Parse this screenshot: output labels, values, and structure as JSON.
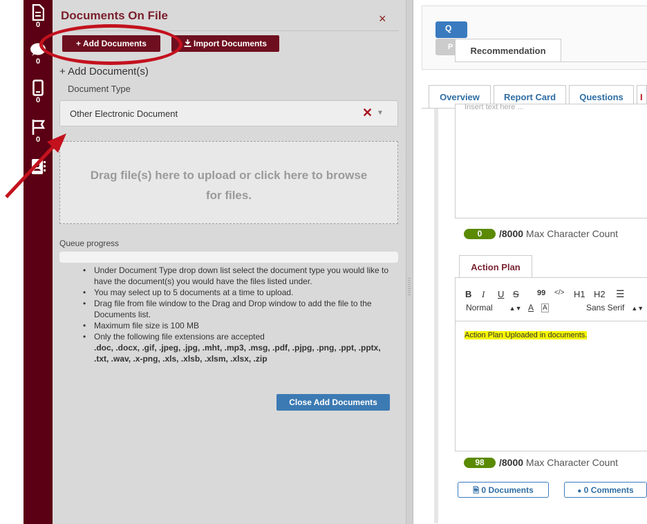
{
  "colors": {
    "rail": "#5b0014",
    "accent_maroon": "#6e0f1f",
    "primary_blue": "#3a7bbf",
    "count_green": "#5a8a00",
    "highlight": "#f5f500",
    "annotation_red": "#c3121e"
  },
  "rail": {
    "items": [
      {
        "icon": "document-icon",
        "count": "0"
      },
      {
        "icon": "comment-icon",
        "count": "0"
      },
      {
        "icon": "mobile-icon",
        "count": "0"
      },
      {
        "icon": "flag-icon",
        "count": "0"
      },
      {
        "icon": "address-book-icon",
        "count": ""
      }
    ]
  },
  "panel": {
    "title": "Documents On File",
    "close_glyph": "×",
    "add_documents_label": "+ Add Documents",
    "import_documents_label": "Import Documents",
    "add_heading": "+ Add Document(s)",
    "doc_type_label": "Document Type",
    "doc_type_value": "Other Electronic Document",
    "dropzone_text": "Drag file(s) here to upload or click here to browse for files.",
    "queue_label": "Queue progress",
    "instructions": [
      "Under Document Type drop down list select the document type you would like to have the document(s) you would have the files listed under.",
      "You may select up to 5 documents at a time to upload.",
      "Drag file from file window to the Drag and Drop window to add the file to the Documents list.",
      "Maximum file size is 100 MB",
      "Only the following file extensions are accepted"
    ],
    "extensions": ".doc, .docx, .gif, .jpeg, .jpg, .mht, .mp3, .msg, .pdf, .pjpg, .png, .ppt, .pptx, .txt, .wav, .x-png, .xls, .xlsb, .xlsm, .xlsx, .zip",
    "close_add_documents_label": "Close Add Documents"
  },
  "right": {
    "search_label": "Q",
    "p_label": "P",
    "recommendation_tab": "Recommendation",
    "tabs": [
      "Overview",
      "Report Card",
      "Questions",
      "I"
    ],
    "editor1_hint": "Insert text here ...",
    "char_count_1": "0",
    "char_max_1": "/8000",
    "char_max_suffix": " Max Character Count",
    "action_plan_tab": "Action Plan",
    "toolbar": {
      "bold": "B",
      "italic": "I",
      "underline": "U",
      "strike": "S",
      "quote": "99",
      "code": "</>",
      "h1": "H1",
      "h2": "H2",
      "normal": "Normal",
      "color_a": "A",
      "sans_serif": "Sans Serif"
    },
    "editor2_text": "Action Plan Uploaded in documents.",
    "char_count_2": "98",
    "char_max_2": "/8000",
    "documents_btn": {
      "count": "0",
      "label": "Documents"
    },
    "comments_btn": {
      "count": "0",
      "label": "Comments"
    }
  }
}
